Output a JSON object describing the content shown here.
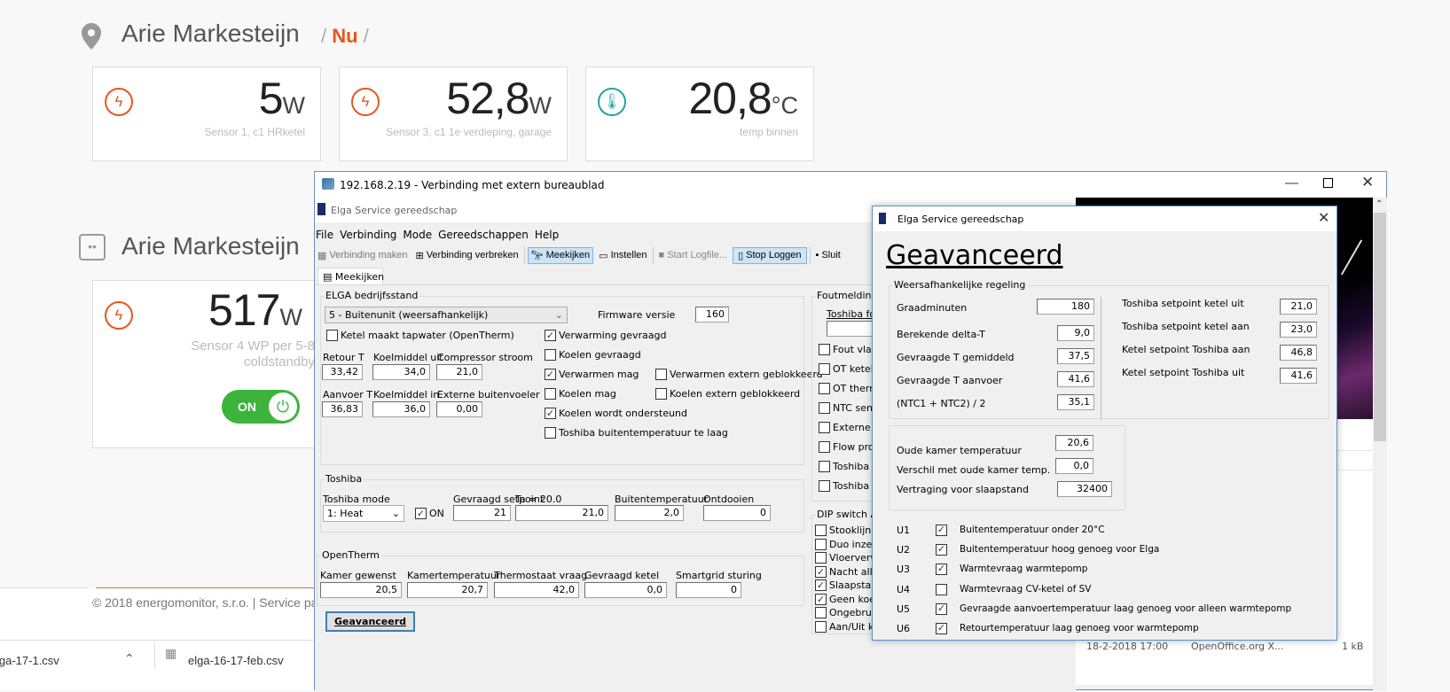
{
  "web": {
    "site_name": "Arie Markesteijn",
    "crumb_sep": "/",
    "crumb_current": "Nu",
    "cards": [
      {
        "value": "5",
        "unit": "W",
        "label": "Sensor 1, c1 HRketel",
        "icon": "lightning-icon"
      },
      {
        "value": "52,8",
        "unit": "W",
        "label": "Sensor 3, c1 1e verdieping, garage",
        "icon": "lightning-icon"
      },
      {
        "value": "20,8",
        "unit": "°C",
        "label": "temp binnen",
        "icon": "thermometer-icon"
      }
    ],
    "socket": {
      "name": "Arie Markesteijn",
      "value": "517",
      "unit": "W",
      "label": "Sensor 4 WP per 5-8 coldstandby",
      "toggle": "ON"
    },
    "footer": "© 2018 energomonitor, s.r.o. | Service pa",
    "colors": {
      "accent": "#e8561c",
      "teal": "#1fa3a3",
      "toggle": "#3cb43c"
    }
  },
  "downloads": {
    "item1": "lga-17-1.csv",
    "item2": "elga-16-17-feb.csv"
  },
  "rdp": {
    "title": "192.168.2.19 - Verbinding met extern bureaublad"
  },
  "app": {
    "title": "Elga Service gereedschap",
    "menu": [
      "File",
      "Verbinding",
      "Mode",
      "Gereedschappen",
      "Help"
    ],
    "toolbar": [
      "Verbinding maken",
      "Verbinding verbreken",
      "Meekijken",
      "Instellen",
      "Start Logfile...",
      "Stop Loggen",
      "Sluit"
    ],
    "tab": "Meekijken",
    "bedrijf": {
      "label": "ELGA bedrijfsstand",
      "mode": "5 - Buitenunit  (weersafhankelijk)",
      "fw_label": "Firmware versie",
      "fw": "160",
      "tapwater": "Ketel maakt tapwater (OpenTherm)",
      "fields": [
        {
          "label": "Retour T",
          "value": "33,42"
        },
        {
          "label": "Koelmiddel uit",
          "value": "34,0"
        },
        {
          "label": "Compressor stroom",
          "value": "21,0"
        },
        {
          "label": "Aanvoer T",
          "value": "36,83"
        },
        {
          "label": "Koelmiddel in",
          "value": "36,0"
        },
        {
          "label": "Externe buitenvoeler",
          "value": "0,00"
        }
      ],
      "checks": [
        {
          "label": "Verwarming gevraagd",
          "checked": true
        },
        {
          "label": "Koelen gevraagd",
          "checked": false
        },
        {
          "label": "Verwarmen mag",
          "checked": true
        },
        {
          "label": "Koelen mag",
          "checked": false
        },
        {
          "label": "Koelen wordt ondersteund",
          "checked": true
        },
        {
          "label": "Toshiba buitentemperatuur te laag",
          "checked": false
        },
        {
          "label": "Verwarmen extern geblokkeerd",
          "checked": false
        },
        {
          "label": "Koelen extern geblokkeerd",
          "checked": false
        }
      ]
    },
    "toshiba": {
      "label": "Toshiba",
      "mode_label": "Toshiba mode",
      "mode": "1: Heat",
      "on": "ON",
      "fields": [
        {
          "label": "Gevraagd setpoint",
          "value": "21"
        },
        {
          "label": "Ta = 20.0",
          "value": "21,0"
        },
        {
          "label": "Buitentemperatuur",
          "value": "2,0"
        },
        {
          "label": "Ontdooien",
          "value": "0"
        }
      ]
    },
    "opentherm": {
      "label": "OpenTherm",
      "fields": [
        {
          "label": "Kamer gewenst",
          "value": "20,5"
        },
        {
          "label": "Kamertemperatuur",
          "value": "20,7"
        },
        {
          "label": "Thermostaat vraag",
          "value": "42,0"
        },
        {
          "label": "Gevraagd ketel",
          "value": "0,0"
        },
        {
          "label": "Smartgrid sturing",
          "value": "0"
        }
      ]
    },
    "geavanceerd_btn": "Geavanceerd",
    "fout": {
      "label": "Foutmeldingen",
      "sub": "Toshiba fou",
      "checks": [
        "Fout vlag",
        "OT ketel g",
        "OT thermo",
        "NTC senso",
        "Externe b",
        "Flow prob",
        "Toshiba co",
        "Toshiba ra"
      ]
    },
    "dip": {
      "label": "DIP switch A",
      "checks": [
        {
          "label": "Stooklijn h",
          "checked": false
        },
        {
          "label": "Duo inzet",
          "checked": false
        },
        {
          "label": "Vloerverwa",
          "checked": false
        },
        {
          "label": "Nacht allee",
          "checked": true
        },
        {
          "label": "Slaapstand",
          "checked": true
        },
        {
          "label": "Geen koelf",
          "checked": true
        },
        {
          "label": "Ongebruikt",
          "checked": false
        },
        {
          "label": "Aan/Uit ke",
          "checked": false
        }
      ]
    }
  },
  "dialog": {
    "title": "Elga Service gereedschap",
    "heading": "Geavanceerd",
    "group1": "Weersafhankelijke regeling",
    "left": [
      {
        "label": "Graadminuten",
        "value": "180"
      },
      {
        "label": "Berekende delta-T",
        "value": "9,0"
      },
      {
        "label": "Gevraagde T gemiddeld",
        "value": "37,5"
      },
      {
        "label": "Gevraagde T aanvoer",
        "value": "41,6"
      },
      {
        "label": "(NTC1 + NTC2) / 2",
        "value": "35,1"
      }
    ],
    "right": [
      {
        "label": "Toshiba setpoint ketel uit",
        "value": "21,0"
      },
      {
        "label": "Toshiba setpoint ketel aan",
        "value": "23,0"
      },
      {
        "label": "Ketel setpoint Toshiba aan",
        "value": "46,8"
      },
      {
        "label": "Ketel setpoint Toshiba uit",
        "value": "41,6"
      }
    ],
    "group2": [
      {
        "label": "Oude kamer temperatuur",
        "value": "20,6"
      },
      {
        "label": "Verschil met oude kamer temp.",
        "value": "0,0"
      },
      {
        "label": "Vertraging voor slaapstand",
        "value": "32400"
      }
    ],
    "u": [
      {
        "id": "U1",
        "label": "Buitentemperatuur onder 20°C",
        "checked": true
      },
      {
        "id": "U2",
        "label": "Buitentemperatuur hoog genoeg voor Elga",
        "checked": true
      },
      {
        "id": "U3",
        "label": "Warmtevraag warmtepomp",
        "checked": true
      },
      {
        "id": "U4",
        "label": "Warmtevraag CV-ketel of SV",
        "checked": false
      },
      {
        "id": "U5",
        "label": "Gevraagde aanvoertemperatuur laag genoeg voor alleen warmtepomp",
        "checked": true
      },
      {
        "id": "U6",
        "label": "Retourtemperatuur laag genoeg voor warmtepomp",
        "checked": true
      }
    ]
  },
  "filelist": {
    "date": "18-2-2018 17:00",
    "type": "OpenOffice.org X...",
    "size": "1 kB"
  }
}
